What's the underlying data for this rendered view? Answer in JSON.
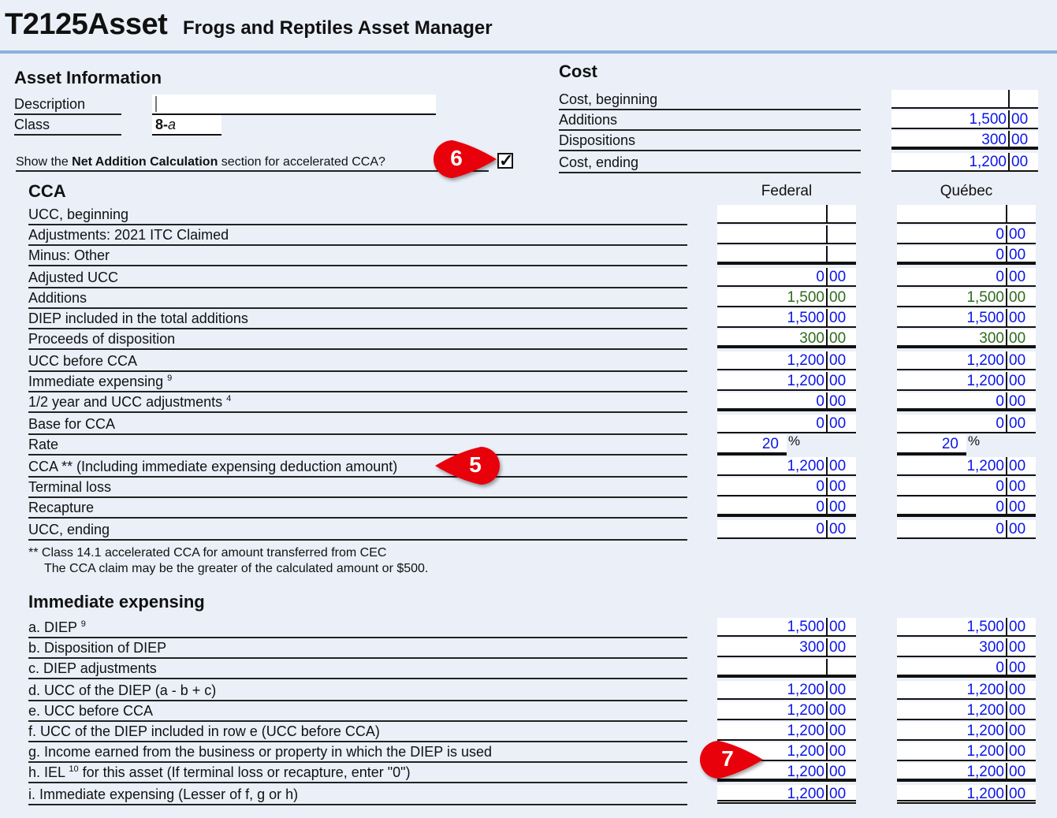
{
  "header": {
    "form_code": "T2125Asset",
    "title": "Frogs and Reptiles Asset Manager"
  },
  "asset_info": {
    "heading": "Asset Information",
    "description_label": "Description",
    "description_value": "",
    "class_label": "Class",
    "class_value_main": "8-",
    "class_value_suffix": "a",
    "net_addition_prompt_pre": "Show the ",
    "net_addition_prompt_bold": "Net Addition Calculation",
    "net_addition_prompt_post": " section for accelerated CCA?",
    "net_addition_checked": true,
    "checkbox_glyph": "✓"
  },
  "cost": {
    "heading": "Cost",
    "rows": [
      {
        "label": "Cost, beginning",
        "dollars": "",
        "cents": ""
      },
      {
        "label": "Additions",
        "dollars": "1,500",
        "cents": "00"
      },
      {
        "label": "Dispositions",
        "dollars": "300",
        "cents": "00"
      },
      {
        "label": "Cost, ending",
        "dollars": "1,200",
        "cents": "00"
      }
    ]
  },
  "cca": {
    "heading": "CCA",
    "federal_header": "Federal",
    "quebec_header": "Québec",
    "percent_sign": "%",
    "rows": [
      {
        "label": "UCC, beginning",
        "sup": "",
        "fed": [
          "",
          ""
        ],
        "qc": [
          "",
          ""
        ],
        "fed_color": "blue",
        "qc_color": "blue"
      },
      {
        "label": "Adjustments: 2021 ITC Claimed",
        "sup": "",
        "fed": [
          "",
          ""
        ],
        "qc": [
          "0",
          "00"
        ],
        "fed_color": "blue",
        "qc_color": "blue"
      },
      {
        "label": "Minus: Other",
        "sup": "",
        "fed": [
          "",
          ""
        ],
        "qc": [
          "0",
          "00"
        ],
        "fed_color": "blue",
        "qc_color": "blue"
      },
      {
        "label": "Adjusted UCC",
        "sup": "",
        "fed": [
          "0",
          "00"
        ],
        "qc": [
          "0",
          "00"
        ],
        "fed_color": "blue",
        "qc_color": "blue"
      },
      {
        "label": "Additions",
        "sup": "",
        "fed": [
          "1,500",
          "00"
        ],
        "qc": [
          "1,500",
          "00"
        ],
        "fed_color": "green",
        "qc_color": "green"
      },
      {
        "label": "DIEP included in the total additions",
        "sup": "",
        "fed": [
          "1,500",
          "00"
        ],
        "qc": [
          "1,500",
          "00"
        ],
        "fed_color": "blue",
        "qc_color": "blue"
      },
      {
        "label": "Proceeds of disposition",
        "sup": "",
        "fed": [
          "300",
          "00"
        ],
        "qc": [
          "300",
          "00"
        ],
        "fed_color": "green",
        "qc_color": "green"
      },
      {
        "label": "UCC before CCA",
        "sup": "",
        "fed": [
          "1,200",
          "00"
        ],
        "qc": [
          "1,200",
          "00"
        ],
        "fed_color": "blue",
        "qc_color": "blue"
      },
      {
        "label": "Immediate expensing ",
        "sup": "9",
        "fed": [
          "1,200",
          "00"
        ],
        "qc": [
          "1,200",
          "00"
        ],
        "fed_color": "blue",
        "qc_color": "blue"
      },
      {
        "label": "1/2 year and UCC adjustments ",
        "sup": "4",
        "fed": [
          "0",
          "00"
        ],
        "qc": [
          "0",
          "00"
        ],
        "fed_color": "blue",
        "qc_color": "blue"
      },
      {
        "label": "Base for CCA",
        "sup": "",
        "fed": [
          "0",
          "00"
        ],
        "qc": [
          "0",
          "00"
        ],
        "fed_color": "blue",
        "qc_color": "blue"
      },
      {
        "label": "Rate",
        "sup": "",
        "fed_rate": "20",
        "qc_rate": "20"
      },
      {
        "label": "CCA ** (Including immediate expensing deduction amount)",
        "sup": "",
        "fed": [
          "1,200",
          "00"
        ],
        "qc": [
          "1,200",
          "00"
        ],
        "fed_color": "blue",
        "qc_color": "blue"
      },
      {
        "label": "Terminal loss",
        "sup": "",
        "fed": [
          "0",
          "00"
        ],
        "qc": [
          "0",
          "00"
        ],
        "fed_color": "blue",
        "qc_color": "blue"
      },
      {
        "label": "Recapture",
        "sup": "",
        "fed": [
          "0",
          "00"
        ],
        "qc": [
          "0",
          "00"
        ],
        "fed_color": "blue",
        "qc_color": "blue"
      },
      {
        "label": "UCC, ending",
        "sup": "",
        "fed": [
          "0",
          "00"
        ],
        "qc": [
          "0",
          "00"
        ],
        "fed_color": "blue",
        "qc_color": "blue"
      }
    ],
    "footnote_line1": "** Class 14.1 accelerated CCA for amount transferred from CEC",
    "footnote_line2": "The CCA claim may be the greater of the calculated amount or $500."
  },
  "immediate_expensing": {
    "heading": "Immediate expensing",
    "rows": [
      {
        "label_pre": "a. DIEP ",
        "sup": "9",
        "label_post": "",
        "fed": [
          "1,500",
          "00"
        ],
        "qc": [
          "1,500",
          "00"
        ]
      },
      {
        "label_pre": "b. Disposition of DIEP",
        "sup": "",
        "label_post": "",
        "fed": [
          "300",
          "00"
        ],
        "qc": [
          "300",
          "00"
        ]
      },
      {
        "label_pre": "c. DIEP adjustments",
        "sup": "",
        "label_post": "",
        "fed": [
          "",
          ""
        ],
        "qc": [
          "0",
          "00"
        ]
      },
      {
        "label_pre": "d. UCC of the DIEP (a - b + c)",
        "sup": "",
        "label_post": "",
        "fed": [
          "1,200",
          "00"
        ],
        "qc": [
          "1,200",
          "00"
        ]
      },
      {
        "label_pre": "e. UCC before CCA",
        "sup": "",
        "label_post": "",
        "fed": [
          "1,200",
          "00"
        ],
        "qc": [
          "1,200",
          "00"
        ]
      },
      {
        "label_pre": "f. UCC of the DIEP included in row e (UCC before CCA)",
        "sup": "",
        "label_post": "",
        "fed": [
          "1,200",
          "00"
        ],
        "qc": [
          "1,200",
          "00"
        ]
      },
      {
        "label_pre": "g. Income earned from the business or property in which the DIEP is used",
        "sup": "",
        "label_post": "",
        "fed": [
          "1,200",
          "00"
        ],
        "qc": [
          "1,200",
          "00"
        ]
      },
      {
        "label_pre": "h. IEL ",
        "sup": "10",
        "label_post": " for this asset (If terminal loss or recapture, enter \"0\")",
        "fed": [
          "1,200",
          "00"
        ],
        "qc": [
          "1,200",
          "00"
        ]
      },
      {
        "label_pre": "i. Immediate expensing (Lesser of f, g or h)",
        "sup": "",
        "label_post": "",
        "fed": [
          "1,200",
          "00"
        ],
        "qc": [
          "1,200",
          "00"
        ]
      }
    ]
  },
  "callouts": [
    {
      "number": "6",
      "color": "#e8000b"
    },
    {
      "number": "5",
      "color": "#e8000b"
    },
    {
      "number": "7",
      "color": "#e8000b"
    }
  ]
}
